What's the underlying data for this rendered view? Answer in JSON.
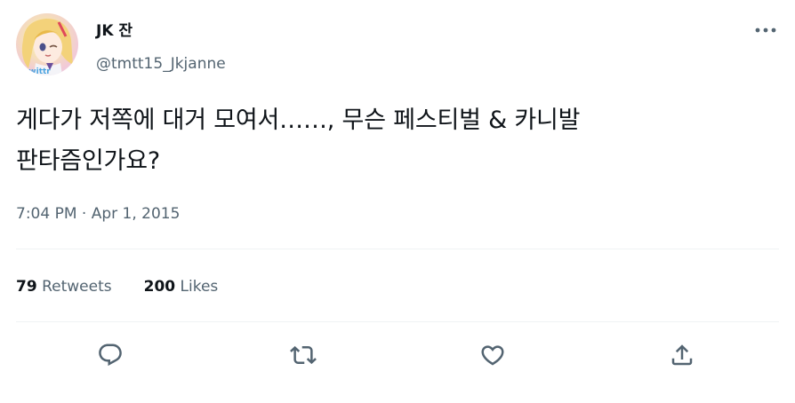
{
  "author": {
    "display_name": "JK 잔",
    "handle": "@tmtt15_Jkjanne"
  },
  "tweet": {
    "text": "게다가 저쪽에 대거 모여서……, 무슨 페스티벌 & 카니발\n판타즘인가요?",
    "time": "7:04 PM",
    "separator": " · ",
    "date": "Apr 1, 2015"
  },
  "stats": {
    "retweets_count": "79",
    "retweets_label": "Retweets",
    "likes_count": "200",
    "likes_label": "Likes"
  },
  "icons": {
    "more": "more-horizontal-icon",
    "reply": "reply-icon",
    "retweet": "retweet-icon",
    "like": "heart-icon",
    "share": "share-icon"
  },
  "colors": {
    "text_primary": "#0f1419",
    "text_secondary": "#536471",
    "divider": "#eff3f4"
  }
}
